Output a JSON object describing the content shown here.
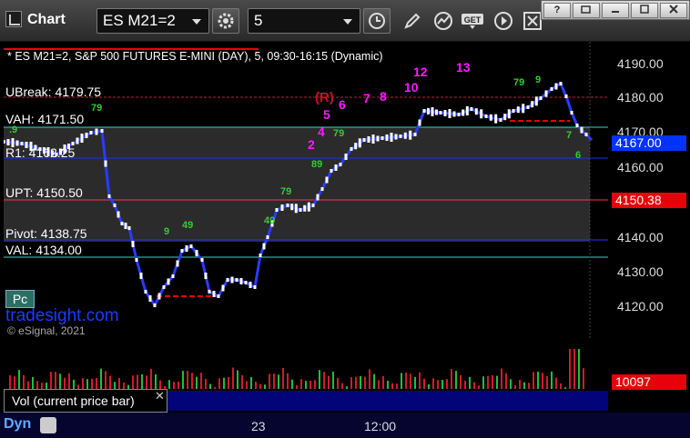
{
  "toolbar": {
    "title": "Chart",
    "symbol": "ES M21=2",
    "interval": "5",
    "icons": [
      "settings-icon",
      "clock-icon",
      "pencil-icon",
      "indicator-icon",
      "get-icon",
      "play-icon",
      "close-box-icon"
    ],
    "window_buttons": [
      "?",
      "restore",
      "minimize",
      "maximize",
      "close"
    ]
  },
  "header": "* ES M21=2, S&P 500 FUTURES E-MINI (DAY), 5, 09:30-16:15 (Dynamic)",
  "levels": {
    "ubreak": "UBreak: 4179.75",
    "vah": "VAH: 4171.50",
    "r1": "R1: 4162.25",
    "upt": "UPT: 4150.50",
    "pivot": "Pivot: 4138.75",
    "val": "VAL: 4134.00"
  },
  "axis": {
    "ticks": [
      "4190.00",
      "4180.00",
      "4170.00",
      "4160.00",
      "4140.00",
      "4130.00",
      "4120.00"
    ],
    "last_price": "4167.00",
    "marker_price": "4150.38",
    "volume_value": "10097"
  },
  "colors": {
    "last_price_bg": "#0033ff",
    "marker_bg": "#e8000a",
    "volume_bg": "#e8000a"
  },
  "pc_label": "Pc",
  "brand": "tradesight.com",
  "copyright": "© eSignal, 2021",
  "volume_legend": "Vol (current price bar)",
  "x_labels": [
    "23",
    "12:00"
  ],
  "dyn_label": "Dyn",
  "sequence_numbers": [
    "2",
    "4",
    "5",
    "6",
    "7",
    "8",
    "10",
    "12",
    "13"
  ],
  "setup_label": "(R)"
}
